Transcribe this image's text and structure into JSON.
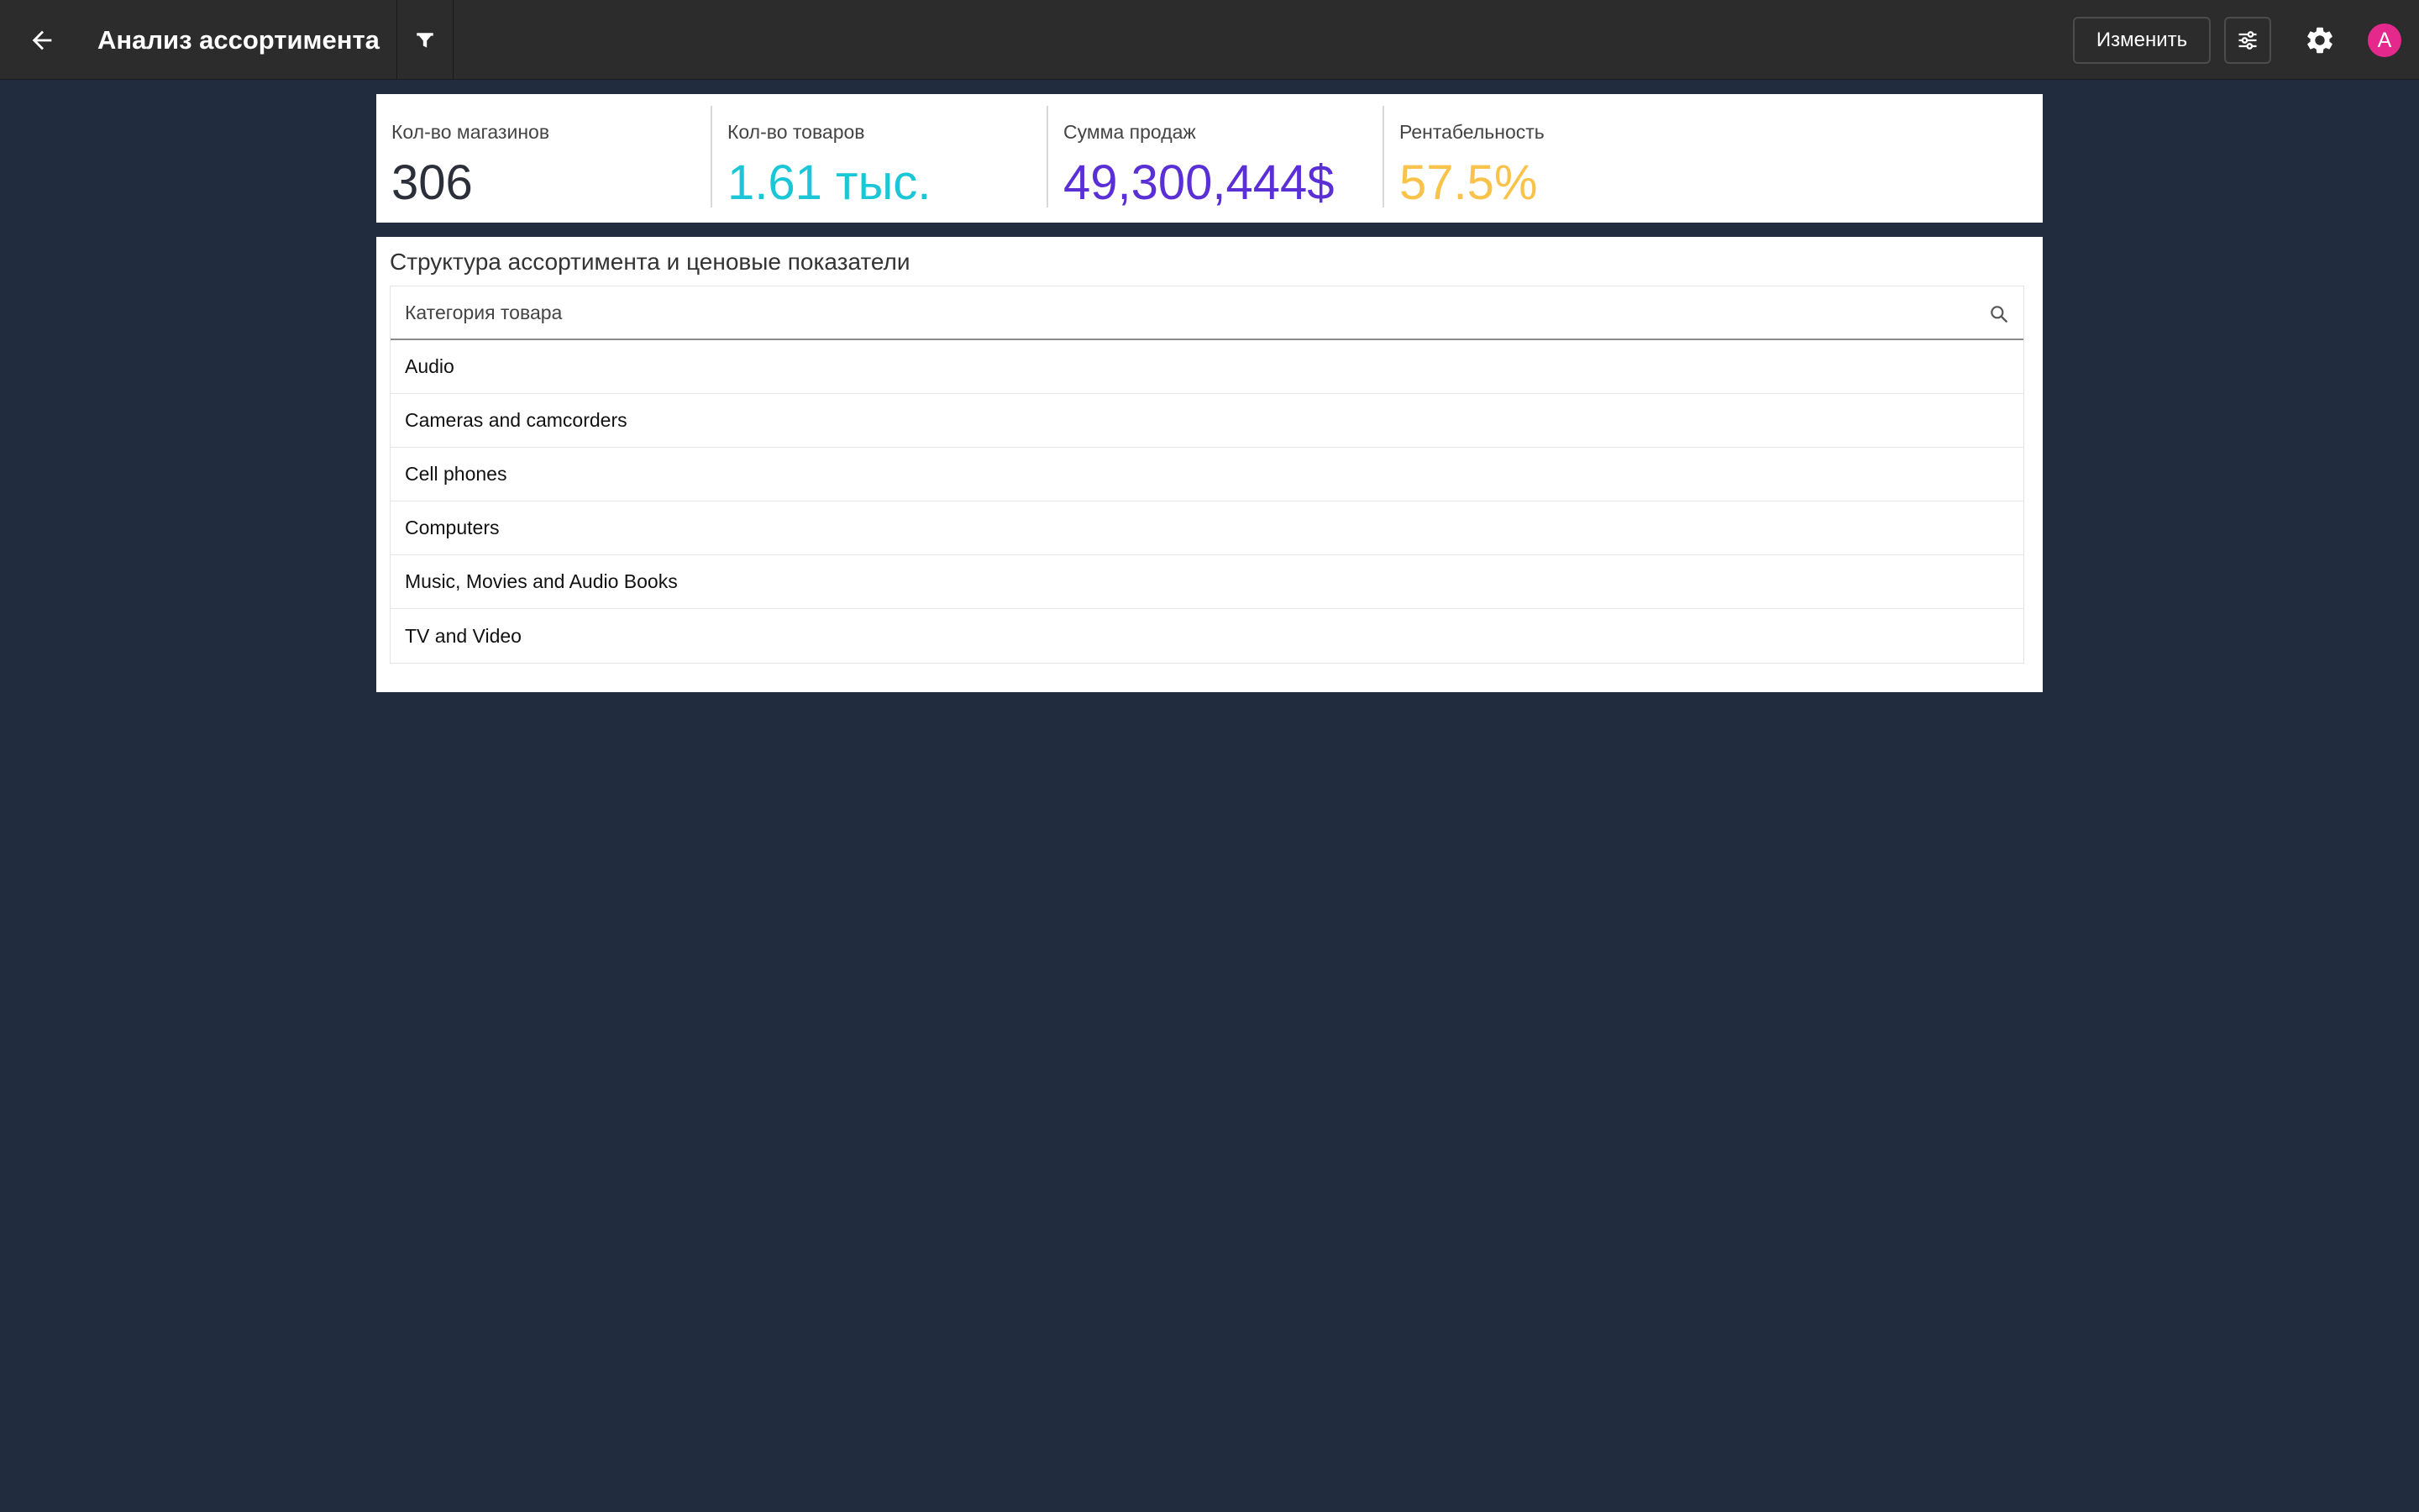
{
  "header": {
    "title": "Анализ ассортимента",
    "edit_label": "Изменить",
    "avatar_letter": "A",
    "icons": {
      "back": "arrow-left-icon",
      "filter": "funnel-icon",
      "sliders": "sliders-icon",
      "settings": "gear-icon"
    }
  },
  "kpis": [
    {
      "label": "Кол-во магазинов",
      "value": "306",
      "color": "#2a2f3a"
    },
    {
      "label": "Кол-во товаров",
      "value": "1.61 тыс.",
      "color": "#1bc6d6"
    },
    {
      "label": "Сумма продаж",
      "value": "49,300,444$",
      "color": "#5a2fd6"
    },
    {
      "label": "Рентабельность",
      "value": "57.5%",
      "color": "#f9c24b"
    }
  ],
  "structure": {
    "title": "Структура ассортимента и ценовые показатели",
    "column_header": "Категория товара",
    "rows": [
      "Audio",
      "Cameras and camcorders",
      "Cell phones",
      "Computers",
      "Music, Movies and Audio Books",
      "TV and Video"
    ]
  },
  "colors": {
    "background": "#212d3e",
    "topbar": "#2c2c2c",
    "avatar": "#e5288c"
  }
}
